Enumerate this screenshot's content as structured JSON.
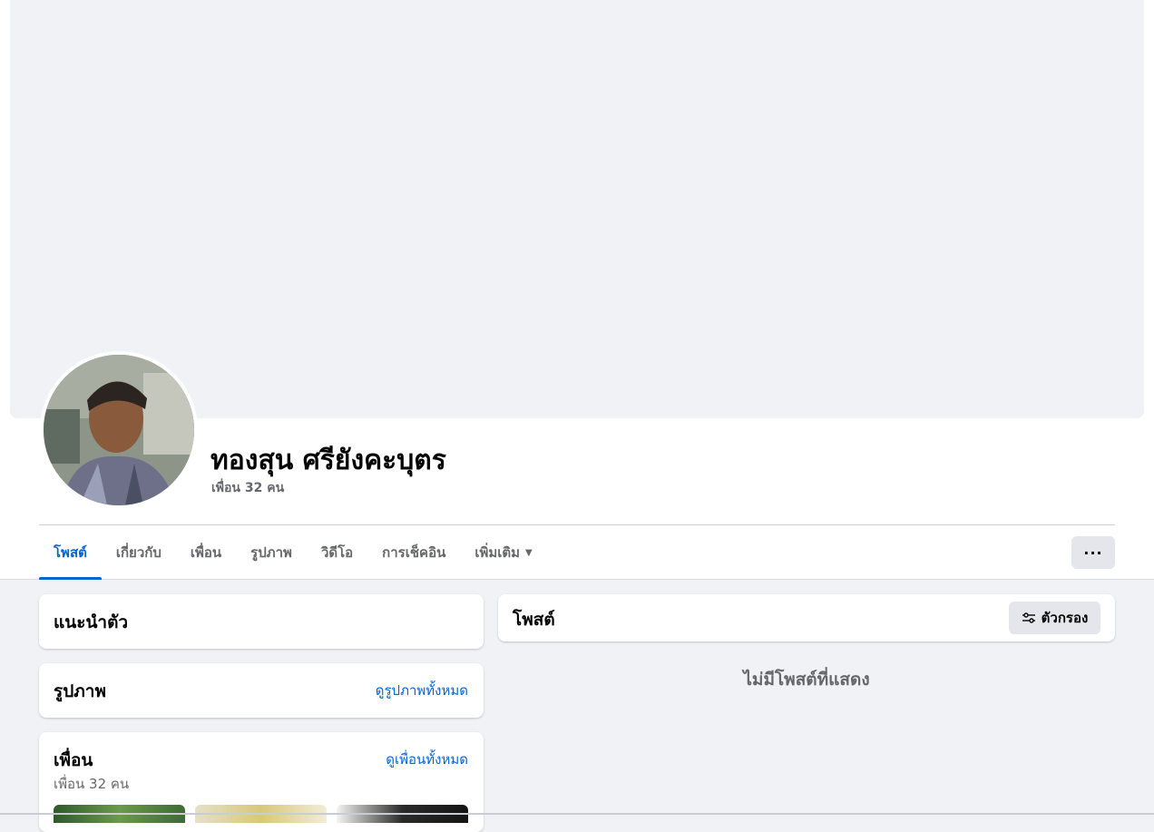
{
  "profile": {
    "name": "ทองสุน ศรียังคะบุตร",
    "friend_count": "เพื่อน 32 คน"
  },
  "tabs": [
    {
      "label": "โพสต์",
      "active": true
    },
    {
      "label": "เกี่ยวกับ",
      "active": false
    },
    {
      "label": "เพื่อน",
      "active": false
    },
    {
      "label": "รูปภาพ",
      "active": false
    },
    {
      "label": "วิดีโอ",
      "active": false
    },
    {
      "label": "การเช็คอิน",
      "active": false
    },
    {
      "label": "เพิ่มเติม",
      "active": false
    }
  ],
  "more_button": "···",
  "intro": {
    "title": "แนะนำตัว"
  },
  "photos": {
    "title": "รูปภาพ",
    "see_all": "ดูรูปภาพทั้งหมด"
  },
  "friends": {
    "title": "เพื่อน",
    "see_all": "ดูเพื่อนทั้งหมด",
    "count": "เพื่อน 32 คน"
  },
  "posts": {
    "title": "โพสต์",
    "filter_label": "ตัวกรอง",
    "empty_message": "ไม่มีโพสต์ที่แสดง"
  },
  "colors": {
    "accent": "#0064d1",
    "background": "#f0f2f5",
    "secondary_text": "#65676b"
  },
  "icons": {
    "more": "more-horizontal-icon",
    "filter": "filter-sliders-icon",
    "caret": "caret-down-icon"
  }
}
